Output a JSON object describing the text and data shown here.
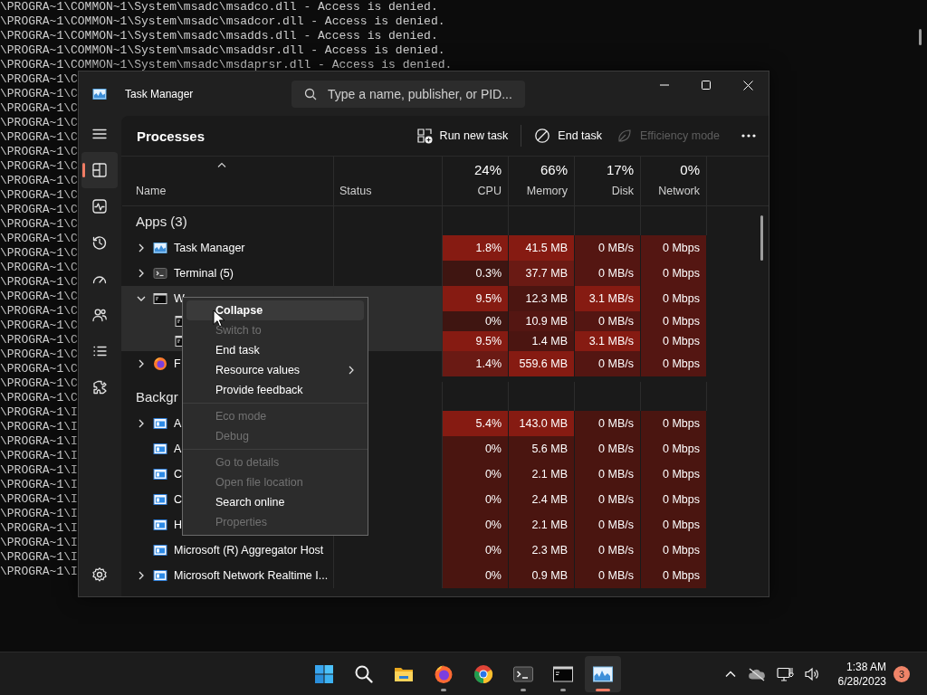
{
  "console": {
    "lines": [
      "\\PROGRA~1\\COMMON~1\\System\\msadc\\msadco.dll - Access is denied.",
      "\\PROGRA~1\\COMMON~1\\System\\msadc\\msadcor.dll - Access is denied.",
      "\\PROGRA~1\\COMMON~1\\System\\msadc\\msadds.dll - Access is denied.",
      "\\PROGRA~1\\COMMON~1\\System\\msadc\\msaddsr.dll - Access is denied.",
      "\\PROGRA~1\\COMMON~1\\System\\msadc\\msdaprsr.dll - Access is denied.",
      "\\PROGRA~1\\C",
      "\\PROGRA~1\\C",
      "\\PROGRA~1\\C",
      "\\PROGRA~1\\C",
      "\\PROGRA~1\\C",
      "\\PROGRA~1\\C",
      "\\PROGRA~1\\C",
      "\\PROGRA~1\\C",
      "\\PROGRA~1\\C",
      "\\PROGRA~1\\C",
      "\\PROGRA~1\\C",
      "\\PROGRA~1\\C",
      "\\PROGRA~1\\C",
      "\\PROGRA~1\\C",
      "\\PROGRA~1\\C",
      "\\PROGRA~1\\C",
      "\\PROGRA~1\\C",
      "\\PROGRA~1\\C",
      "\\PROGRA~1\\C",
      "\\PROGRA~1\\C",
      "\\PROGRA~1\\C",
      "\\PROGRA~1\\C",
      "\\PROGRA~1\\C",
      "\\PROGRA~1\\I",
      "\\PROGRA~1\\I",
      "\\PROGRA~1\\I",
      "\\PROGRA~1\\I",
      "\\PROGRA~1\\I",
      "\\PROGRA~1\\I",
      "\\PROGRA~1\\I",
      "\\PROGRA~1\\I",
      "\\PROGRA~1\\I",
      "\\PROGRA~1\\I",
      "\\PROGRA~1\\I",
      "\\PROGRA~1\\I"
    ]
  },
  "task_manager": {
    "title": "Task Manager",
    "search": {
      "placeholder": "Type a name, publisher, or PID..."
    },
    "nav": [
      {
        "kind": "menu",
        "selected": false
      },
      {
        "kind": "processes",
        "selected": true
      },
      {
        "kind": "performance",
        "selected": false
      },
      {
        "kind": "history",
        "selected": false
      },
      {
        "kind": "startup",
        "selected": false
      },
      {
        "kind": "users",
        "selected": false
      },
      {
        "kind": "details",
        "selected": false
      },
      {
        "kind": "services",
        "selected": false
      },
      {
        "kind": "settings",
        "selected": false
      }
    ],
    "page_title": "Processes",
    "toolbar": [
      {
        "kind": "run",
        "label": "Run new task",
        "disabled": false
      },
      {
        "kind": "end",
        "label": "End task",
        "disabled": false
      },
      {
        "kind": "efficiency",
        "label": "Efficiency mode",
        "disabled": true
      },
      {
        "kind": "more",
        "disabled": false
      }
    ],
    "columns": [
      {
        "label": "Name",
        "sorted": true
      },
      {
        "label": "Status",
        "sorted": false
      },
      {
        "usage": "24%",
        "label": "CPU",
        "sorted": false
      },
      {
        "usage": "66%",
        "label": "Memory",
        "sorted": false
      },
      {
        "usage": "17%",
        "label": "Disk",
        "sorted": false
      },
      {
        "usage": "0%",
        "label": "Network",
        "sorted": false
      }
    ],
    "groups": [
      {
        "title": "Apps (3)",
        "rows": [
          {
            "name": "Task Manager",
            "kind": "chart",
            "expandable": true,
            "expanded": false,
            "selected": false,
            "cells": [
              {
                "text": "1.8%",
                "color": "#861b12"
              },
              {
                "text": "41.5 MB",
                "color": "#861b12"
              },
              {
                "text": "0 MB/s",
                "color": "#541612"
              },
              {
                "text": "0 Mbps",
                "color": "#541612"
              }
            ]
          },
          {
            "name": "Terminal (5)",
            "kind": "terminal",
            "expandable": true,
            "expanded": false,
            "selected": false,
            "cells": [
              {
                "text": "0.3%",
                "color": "#3f1511"
              },
              {
                "text": "37.7 MB",
                "color": "#6a1a14"
              },
              {
                "text": "0 MB/s",
                "color": "#541612"
              },
              {
                "text": "0 Mbps",
                "color": "#541612"
              }
            ]
          },
          {
            "name": "W",
            "kind": "console",
            "expandable": true,
            "expanded": true,
            "selected": true,
            "cells": [
              {
                "text": "9.5%",
                "color": "#861b12"
              },
              {
                "text": "12.3 MB",
                "color": "#4b1511"
              },
              {
                "text": "3.1 MB/s",
                "color": "#861b12"
              },
              {
                "text": "0 Mbps",
                "color": "#541612"
              }
            ],
            "children": [
              {
                "kind": "console",
                "expandable": false,
                "selected": true,
                "cells": [
                  {
                    "text": "0%",
                    "color": "#3f1511"
                  },
                  {
                    "text": "10.9 MB",
                    "color": "#541612"
                  },
                  {
                    "text": "0 MB/s",
                    "color": "#541612"
                  },
                  {
                    "text": "0 Mbps",
                    "color": "#541612"
                  }
                ]
              },
              {
                "kind": "console",
                "expandable": false,
                "selected": true,
                "cells": [
                  {
                    "text": "9.5%",
                    "color": "#861b12"
                  },
                  {
                    "text": "1.4 MB",
                    "color": "#4b1511"
                  },
                  {
                    "text": "3.1 MB/s",
                    "color": "#861b12"
                  },
                  {
                    "text": "0 Mbps",
                    "color": "#541612"
                  }
                ]
              }
            ]
          },
          {
            "name": "F",
            "kind": "browser",
            "expandable": true,
            "expanded": false,
            "selected": false,
            "cells": [
              {
                "text": "1.4%",
                "color": "#6a1a14"
              },
              {
                "text": "559.6 MB",
                "color": "#861b12"
              },
              {
                "text": "0 MB/s",
                "color": "#541612"
              },
              {
                "text": "0 Mbps",
                "color": "#541612"
              }
            ]
          }
        ]
      },
      {
        "title": "Backgr",
        "rows": [
          {
            "name": "A",
            "kind": "service",
            "expandable": true,
            "expanded": false,
            "selected": false,
            "cells": [
              {
                "text": "5.4%",
                "color": "#861b12"
              },
              {
                "text": "143.0 MB",
                "color": "#861b12"
              },
              {
                "text": "0 MB/s",
                "color": "#4a1510"
              },
              {
                "text": "0 Mbps",
                "color": "#4a1510"
              }
            ]
          },
          {
            "name": "A",
            "kind": "service",
            "expandable": false,
            "selected": false,
            "cells": [
              {
                "text": "0%",
                "color": "#4a1510"
              },
              {
                "text": "5.6 MB",
                "color": "#4a1510"
              },
              {
                "text": "0 MB/s",
                "color": "#4a1510"
              },
              {
                "text": "0 Mbps",
                "color": "#4a1510"
              }
            ]
          },
          {
            "name": "C",
            "kind": "service",
            "expandable": false,
            "selected": false,
            "cells": [
              {
                "text": "0%",
                "color": "#4a1510"
              },
              {
                "text": "2.1 MB",
                "color": "#4a1510"
              },
              {
                "text": "0 MB/s",
                "color": "#4a1510"
              },
              {
                "text": "0 Mbps",
                "color": "#4a1510"
              }
            ]
          },
          {
            "name": "C",
            "kind": "service",
            "expandable": false,
            "selected": false,
            "cells": [
              {
                "text": "0%",
                "color": "#4a1510"
              },
              {
                "text": "2.4 MB",
                "color": "#4a1510"
              },
              {
                "text": "0 MB/s",
                "color": "#4a1510"
              },
              {
                "text": "0 Mbps",
                "color": "#4a1510"
              }
            ]
          },
          {
            "name": "H",
            "kind": "service",
            "expandable": false,
            "selected": false,
            "cells": [
              {
                "text": "0%",
                "color": "#4a1510"
              },
              {
                "text": "2.1 MB",
                "color": "#4a1510"
              },
              {
                "text": "0 MB/s",
                "color": "#4a1510"
              },
              {
                "text": "0 Mbps",
                "color": "#4a1510"
              }
            ]
          },
          {
            "name": "Microsoft (R) Aggregator Host",
            "kind": "service",
            "expandable": false,
            "selected": false,
            "cells": [
              {
                "text": "0%",
                "color": "#4a1510"
              },
              {
                "text": "2.3 MB",
                "color": "#4a1510"
              },
              {
                "text": "0 MB/s",
                "color": "#4a1510"
              },
              {
                "text": "0 Mbps",
                "color": "#4a1510"
              }
            ]
          },
          {
            "name": "Microsoft Network Realtime I...",
            "kind": "service",
            "expandable": true,
            "expanded": false,
            "selected": false,
            "cells": [
              {
                "text": "0%",
                "color": "#4a1510"
              },
              {
                "text": "0.9 MB",
                "color": "#4a1510"
              },
              {
                "text": "0 MB/s",
                "color": "#4a1510"
              },
              {
                "text": "0 Mbps",
                "color": "#4a1510"
              }
            ]
          }
        ]
      }
    ],
    "context_menu": {
      "items": [
        {
          "kind": "item",
          "label": "Collapse",
          "default": true,
          "selected": true,
          "disabled": false,
          "submenu": false
        },
        {
          "kind": "item",
          "label": "Switch to",
          "default": false,
          "selected": false,
          "disabled": true,
          "submenu": false
        },
        {
          "kind": "item",
          "label": "End task",
          "default": false,
          "selected": false,
          "disabled": false,
          "submenu": false
        },
        {
          "kind": "item",
          "label": "Resource values",
          "default": false,
          "selected": false,
          "disabled": false,
          "submenu": true
        },
        {
          "kind": "item",
          "label": "Provide feedback",
          "default": false,
          "selected": false,
          "disabled": false,
          "submenu": false
        },
        {
          "kind": "separator"
        },
        {
          "kind": "item",
          "label": "Eco mode",
          "default": false,
          "selected": false,
          "disabled": true,
          "submenu": false
        },
        {
          "kind": "item",
          "label": "Debug",
          "default": false,
          "selected": false,
          "disabled": true,
          "submenu": false
        },
        {
          "kind": "separator"
        },
        {
          "kind": "item",
          "label": "Go to details",
          "default": false,
          "selected": false,
          "disabled": true,
          "submenu": false
        },
        {
          "kind": "item",
          "label": "Open file location",
          "default": false,
          "selected": false,
          "disabled": true,
          "submenu": false
        },
        {
          "kind": "item",
          "label": "Search online",
          "default": false,
          "selected": false,
          "disabled": false,
          "submenu": false
        },
        {
          "kind": "item",
          "label": "Properties",
          "default": false,
          "selected": false,
          "disabled": true,
          "submenu": false
        }
      ]
    }
  },
  "taskbar": {
    "apps": [
      {
        "kind": "start",
        "running": false,
        "selected": false
      },
      {
        "kind": "search",
        "running": false,
        "selected": false
      },
      {
        "kind": "folder",
        "running": false,
        "selected": false
      },
      {
        "kind": "firefox",
        "running": true,
        "selected": false
      },
      {
        "kind": "chrome",
        "running": false,
        "selected": false
      },
      {
        "kind": "terminal",
        "running": true,
        "selected": false
      },
      {
        "kind": "console",
        "running": true,
        "selected": false
      },
      {
        "kind": "monitor",
        "running": true,
        "selected": true
      }
    ],
    "tray": [
      {
        "kind": "overflow"
      },
      {
        "kind": "cloud"
      },
      {
        "kind": "network"
      },
      {
        "kind": "volume"
      }
    ],
    "time": "1:38 AM",
    "date": "6/28/2023",
    "notifications": "3"
  }
}
